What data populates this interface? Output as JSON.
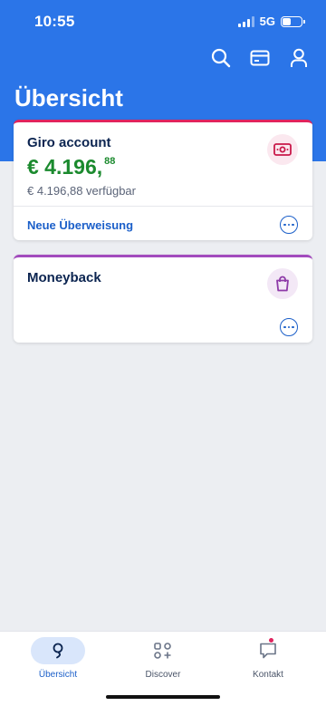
{
  "status_bar": {
    "time": "10:55",
    "network": "5G"
  },
  "header": {
    "title": "Übersicht",
    "actions": [
      "search-icon",
      "card-icon",
      "profile-icon"
    ]
  },
  "accounts": [
    {
      "title": "Giro account",
      "amount_main": "€ 4.196,",
      "amount_cents": "88",
      "available": "€ 4.196,88 verfügbar",
      "action_label": "Neue Überweisung",
      "icon": "banknote-icon",
      "accent": "#e0245e"
    },
    {
      "title": "Moneyback",
      "icon": "shopping-bag-icon",
      "accent": "#a24bbd"
    }
  ],
  "bottom_nav": {
    "items": [
      {
        "label": "Übersicht",
        "icon": "overview-icon",
        "active": true
      },
      {
        "label": "Discover",
        "icon": "discover-icon",
        "active": false
      },
      {
        "label": "Kontakt",
        "icon": "chat-icon",
        "active": false,
        "badge": true
      }
    ]
  },
  "colors": {
    "header_blue": "#2b75e8",
    "link_blue": "#1b5fc9",
    "positive_green": "#1b8a2e",
    "background": "#eceef2"
  }
}
